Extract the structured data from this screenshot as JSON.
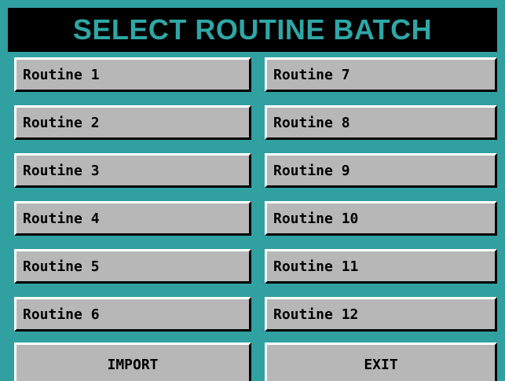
{
  "title": "SELECT ROUTINE BATCH",
  "routines_left": [
    "Routine 1",
    "Routine 2",
    "Routine 3",
    "Routine 4",
    "Routine 5",
    "Routine 6"
  ],
  "routines_right": [
    "Routine 7",
    "Routine 8",
    "Routine 9",
    "Routine 10",
    "Routine 11",
    "Routine 12"
  ],
  "actions": {
    "import_label": "IMPORT",
    "exit_label": "EXIT"
  },
  "colors": {
    "panel_background": "#31a0a0",
    "title_background": "#000000",
    "title_text": "#2fa6a6",
    "button_face": "#b7b7b7",
    "button_text": "#000000"
  }
}
